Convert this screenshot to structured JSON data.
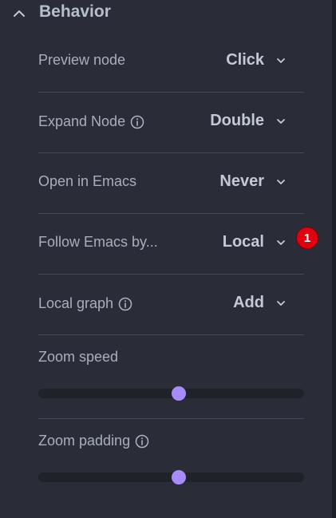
{
  "section": {
    "title": "Behavior",
    "collapse_icon": "chevron-up-icon"
  },
  "rows": [
    {
      "label": "Preview node",
      "value": "Click",
      "has_info": false
    },
    {
      "label": "Expand Node",
      "value": "Double",
      "has_info": true
    },
    {
      "label": "Open in Emacs",
      "value": "Never",
      "has_info": false
    },
    {
      "label": "Follow Emacs by...",
      "value": "Local",
      "has_info": false
    },
    {
      "label": "Local graph",
      "value": "Add",
      "has_info": true
    }
  ],
  "badge": {
    "count": "1",
    "color": "#e0000f"
  },
  "sliders": [
    {
      "label": "Zoom speed",
      "has_info": false,
      "value_fraction": 0.53
    },
    {
      "label": "Zoom padding",
      "has_info": true,
      "value_fraction": 0.53
    }
  ],
  "colors": {
    "background": "#2a2c37",
    "accent": "#a78bfa",
    "divider": "#454957"
  }
}
